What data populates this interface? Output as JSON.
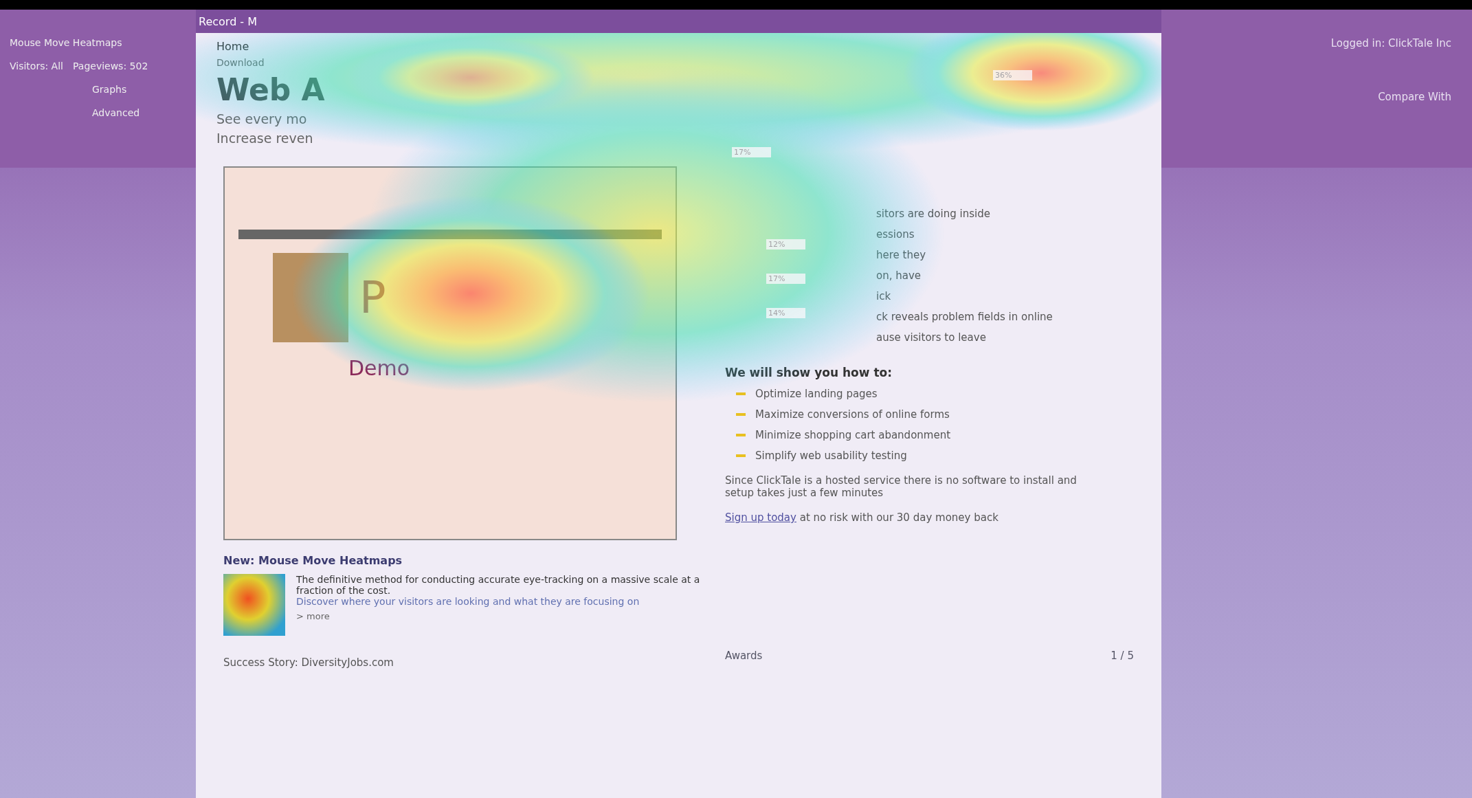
{
  "sidebar_left": {
    "title": "Mouse Move Heatmaps",
    "filters": [
      "Visitors: All",
      "Pageviews: 502"
    ],
    "options": [
      "Graphs",
      "Advanced"
    ]
  },
  "page": {
    "tab": "Record - M",
    "nav": "Home",
    "download": "Download",
    "title": "Web A",
    "subtitles": [
      "See every mo",
      "Increase reven"
    ]
  },
  "preview": {
    "headline": "P",
    "subhead": "Demo"
  },
  "percent_labels": [
    "36%",
    "17%",
    "12%",
    "17%",
    "14%"
  ],
  "features": [
    "sitors are doing inside",
    "essions",
    "here they",
    "on, have",
    "ick",
    "ck reveals problem fields in online",
    "ause visitors to leave"
  ],
  "howto": {
    "heading": "We will show you how to:",
    "items": [
      "Optimize landing pages",
      "Maximize conversions of online forms",
      "Minimize shopping cart abandonment",
      "Simplify web usability testing"
    ]
  },
  "hosted_note": "Since ClickTale is a hosted service there is no software to install and setup takes just a few minutes",
  "signup": {
    "link": "Sign up today",
    "rest": "at no risk with our 30 day money back"
  },
  "news": {
    "heading": "New: Mouse Move Heatmaps",
    "body": "The definitive method for conducting accurate eye-tracking on a massive scale at a fraction of the cost.",
    "link": "Discover where your visitors are looking and what they are focusing on",
    "more": "> more"
  },
  "success": "Success Story: DiversityJobs.com",
  "awards": {
    "title": "Awards",
    "pager": "1 / 5"
  },
  "sidebar_right": {
    "account": "Logged in: ClickTale Inc",
    "compare": "Compare With"
  }
}
